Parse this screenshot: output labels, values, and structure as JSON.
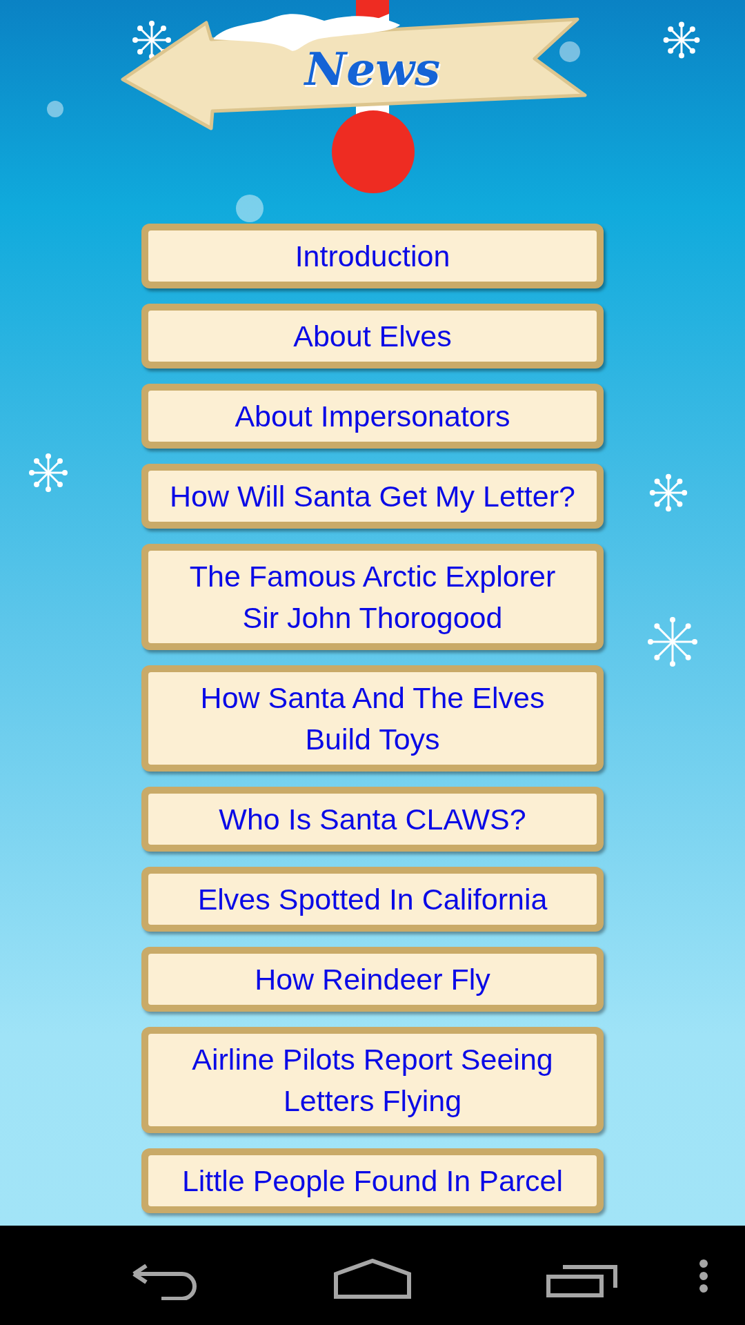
{
  "title": "News",
  "articles": [
    {
      "lines": [
        "Introduction"
      ]
    },
    {
      "lines": [
        "About Elves"
      ]
    },
    {
      "lines": [
        "About Impersonators"
      ]
    },
    {
      "lines": [
        "How Will Santa Get My Letter?"
      ]
    },
    {
      "lines": [
        "The Famous Arctic Explorer",
        "Sir John Thorogood"
      ]
    },
    {
      "lines": [
        "How Santa And The Elves",
        "Build Toys"
      ]
    },
    {
      "lines": [
        "Who Is Santa CLAWS?"
      ]
    },
    {
      "lines": [
        "Elves Spotted In California"
      ]
    },
    {
      "lines": [
        "How Reindeer Fly"
      ]
    },
    {
      "lines": [
        "Airline Pilots Report Seeing",
        "Letters Flying"
      ]
    },
    {
      "lines": [
        "Little People Found In Parcel"
      ]
    }
  ]
}
